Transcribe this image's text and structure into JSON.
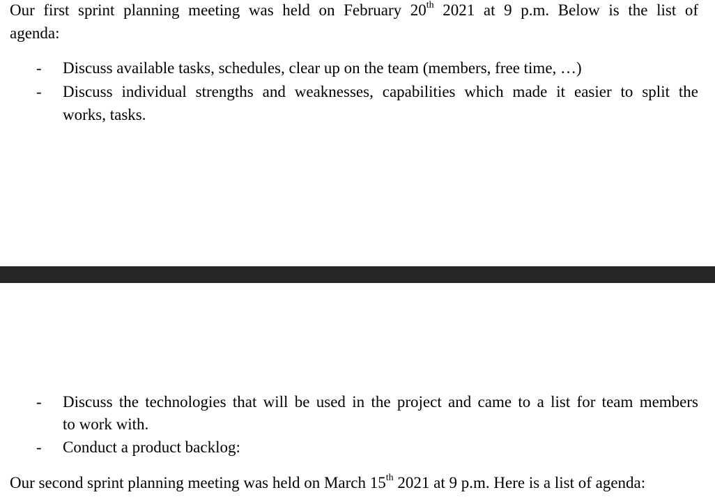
{
  "page1": {
    "intro_line1_a": "Our first sprint planning meeting was held on February 20",
    "intro_line1_sup": "th",
    "intro_line1_b": " 2021 at 9 p.m. Below is the list of",
    "intro_line2": "agenda:",
    "bullets": [
      {
        "dash": "-",
        "line1": "Discuss available tasks, schedules, clear up on the team (members, free time, …)"
      },
      {
        "dash": "-",
        "line1": "Discuss individual strengths and weaknesses, capabilities which made it easier to split the",
        "line2": "works, tasks."
      }
    ]
  },
  "page2": {
    "bullets": [
      {
        "dash": "-",
        "line1": "Discuss the technologies that will be used in the project and came to a list for team members",
        "line2": "to work with."
      },
      {
        "dash": "-",
        "line1": "Conduct a product backlog:"
      }
    ],
    "outro_a": "Our second sprint planning meeting was held on March 15",
    "outro_sup": "th",
    "outro_b": " 2021 at 9 p.m. Here is a list of agenda:"
  }
}
